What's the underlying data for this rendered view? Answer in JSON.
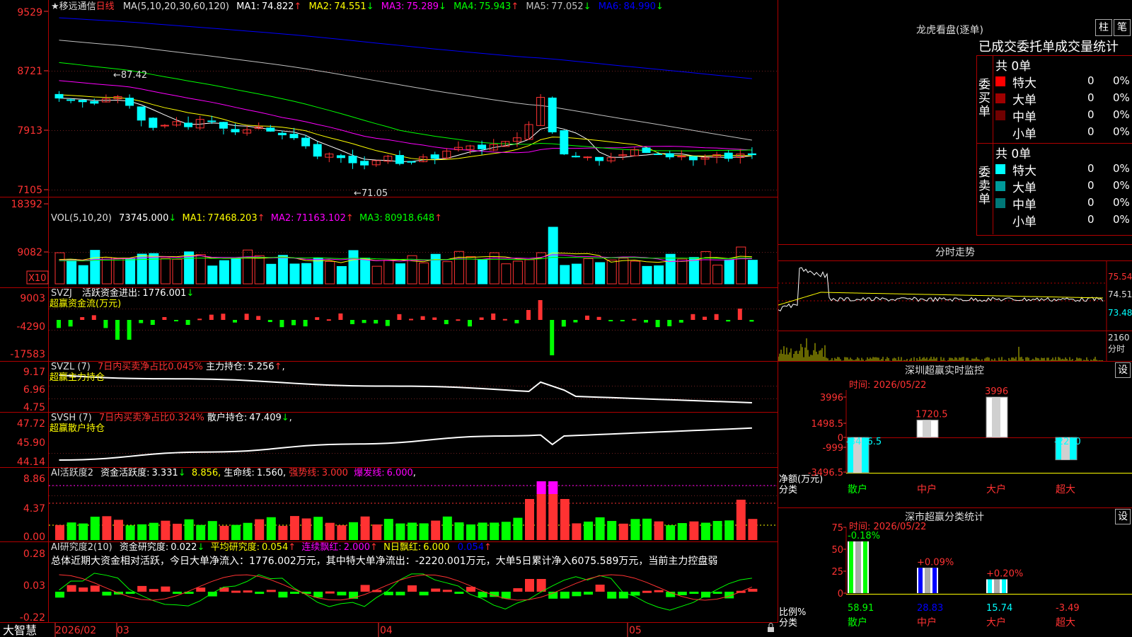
{
  "stock": {
    "star": "★",
    "name": "移远通信",
    "period": "日线"
  },
  "ma_line": {
    "params": "MA(5,10,20,30,60,120)",
    "items": [
      {
        "label": "MA1:",
        "value": "74.822",
        "arrow": "↑",
        "color": "#ffffff"
      },
      {
        "label": "MA2:",
        "value": "74.551",
        "arrow": "↓",
        "color": "#ffff00"
      },
      {
        "label": "MA3:",
        "value": "75.289",
        "arrow": "↓",
        "color": "#ff00ff"
      },
      {
        "label": "MA4:",
        "value": "75.943",
        "arrow": "↑",
        "color": "#00ff00"
      },
      {
        "label": "MA5:",
        "value": "77.052",
        "arrow": "↓",
        "color": "#c0c0c0"
      },
      {
        "label": "MA6:",
        "value": "84.990",
        "arrow": "↓",
        "color": "#0000ff"
      }
    ]
  },
  "price_axis": [
    "9529",
    "8721",
    "7913",
    "7105"
  ],
  "price_marks": {
    "high": "87.42",
    "low": "71.05"
  },
  "vol": {
    "title": "VOL(5,10,20)",
    "value": "73745.000",
    "value_arrow": "↓",
    "items": [
      {
        "label": "MA1:",
        "value": "77468.203",
        "arrow": "↑",
        "color": "#ffff00"
      },
      {
        "label": "MA2:",
        "value": "71163.102",
        "arrow": "↑",
        "color": "#ff00ff"
      },
      {
        "label": "MA3:",
        "value": "80918.648",
        "arrow": "↑",
        "color": "#00ff00"
      }
    ],
    "axis": [
      "18392",
      "9082"
    ],
    "unit": "X10"
  },
  "svzj": {
    "title": "SVZJ",
    "label": "活跃资金进出:",
    "value": "1776.001",
    "arrow": "↓",
    "sub": "超赢资金流(万元)",
    "axis": [
      "9003",
      "-4290",
      "-17583"
    ]
  },
  "svzl": {
    "title": "SVZL (7)",
    "ratio": "7日内买卖净占比0.045%",
    "label": "主力持仓:",
    "value": "5.256",
    "arrow": "↑",
    "tail": ",",
    "sub": "超赢主力持仓",
    "axis": [
      "9.17",
      "6.96",
      "4.75"
    ]
  },
  "svsh": {
    "title": "SVSH (7)",
    "ratio": "7日内买卖净占比0.324%",
    "label": "散户持仓:",
    "value": "47.409",
    "arrow": "↓",
    "tail": ",",
    "sub": "超赢散户持仓",
    "axis": [
      "47.72",
      "45.90",
      "44.14"
    ]
  },
  "ai_active": {
    "title": "AI活跃度2",
    "label1": "资金活跃度:",
    "v1": "3.331",
    "a1": "↓",
    "v2": "8.856",
    "a2": ",",
    "label3": "生命线:",
    "v3": "1.560",
    "t3": ",",
    "label4": "强势线:",
    "v4": "3.000",
    "label5": "爆发线:",
    "v5": "6.000",
    "t5": ",",
    "axis": [
      "8.86",
      "4.37",
      "0.00"
    ]
  },
  "ai_research": {
    "title": "AI研究度2(10)",
    "label1": "资金研究度:",
    "v1": "0.022",
    "a1": "↓",
    "label2": "平均研究度:",
    "v2": "0.054",
    "a2": "↑",
    "label3": "连续飘红:",
    "v3": "2.000",
    "a3": "↑",
    "label4": "N日飘红:",
    "v4": "6.000",
    "label5": "",
    "v5": "0.054",
    "a5": "↑",
    "summary": "总体近期大资金相对活跃，今日大单净流入：1776.002万元，其中特大单净流出：-2220.001万元，大单5日累计净入6075.589万元，当前主力控盘弱",
    "axis": [
      "0.28",
      "0.03",
      "-0.22"
    ]
  },
  "date_axis": {
    "brand": "大智慧",
    "d0": "2026/02",
    "d1": "03",
    "d2": "04",
    "d3": "05"
  },
  "longhu": {
    "title": "龙虎看盘(逐单)",
    "btn1": "柱",
    "btn2": "笔",
    "table_title": "已成交委托单成交量统计",
    "buy_label": "委买单",
    "sell_label": "委卖单",
    "buy_total": "共 0单",
    "sell_total": "共 0单",
    "buy_rows": [
      {
        "name": "特大",
        "count": "0",
        "pct": "0%",
        "color": "#ff0000"
      },
      {
        "name": "大单",
        "count": "0",
        "pct": "0%",
        "color": "#a00000"
      },
      {
        "name": "中单",
        "count": "0",
        "pct": "0%",
        "color": "#700000"
      },
      {
        "name": "小单",
        "count": "0",
        "pct": "0%",
        "color": "#000000"
      }
    ],
    "sell_rows": [
      {
        "name": "特大",
        "count": "0",
        "pct": "0%",
        "color": "#00ffff"
      },
      {
        "name": "大单",
        "count": "0",
        "pct": "0%",
        "color": "#009999"
      },
      {
        "name": "中单",
        "count": "0",
        "pct": "0%",
        "color": "#007777"
      },
      {
        "name": "小单",
        "count": "0",
        "pct": "0%",
        "color": "#000000"
      }
    ]
  },
  "intraday": {
    "title": "分时走势",
    "axis": [
      "75.54",
      "74.51",
      "73.48"
    ],
    "vol_top": "2160",
    "vol_label": "分时"
  },
  "monitor": {
    "title": "深圳超赢实时监控",
    "btn": "设",
    "date": "时间: 2026/05/22",
    "axis": [
      "3996",
      "1498.5",
      "0",
      "-999",
      "-3496.5"
    ],
    "ylabel": "净额(万元)",
    "xlabel": "分类",
    "categories": [
      "散户",
      "中户",
      "大户",
      "超大"
    ],
    "bar_labels": [
      "-3496.5",
      "1720.5",
      "3996",
      "-2220"
    ]
  },
  "classify": {
    "title": "深市超赢分类统计",
    "btn": "设",
    "date": "时间: 2026/05/22",
    "axis": [
      "75",
      "50",
      "25",
      "0"
    ],
    "ylabel": "比例%",
    "xlabel": "分类",
    "categories": [
      "散户",
      "中户",
      "大户",
      "超大"
    ],
    "bar_labels": [
      "-0.18%",
      "+0.09%",
      "+0.20%"
    ],
    "values": [
      "58.91",
      "28.83",
      "15.74",
      "-3.49"
    ]
  },
  "colors": {
    "up": "#ff3232",
    "down": "#00ffff",
    "green": "#00ff00",
    "grid": "#b00000",
    "yellow": "#ffff00",
    "magenta": "#ff00ff"
  }
}
